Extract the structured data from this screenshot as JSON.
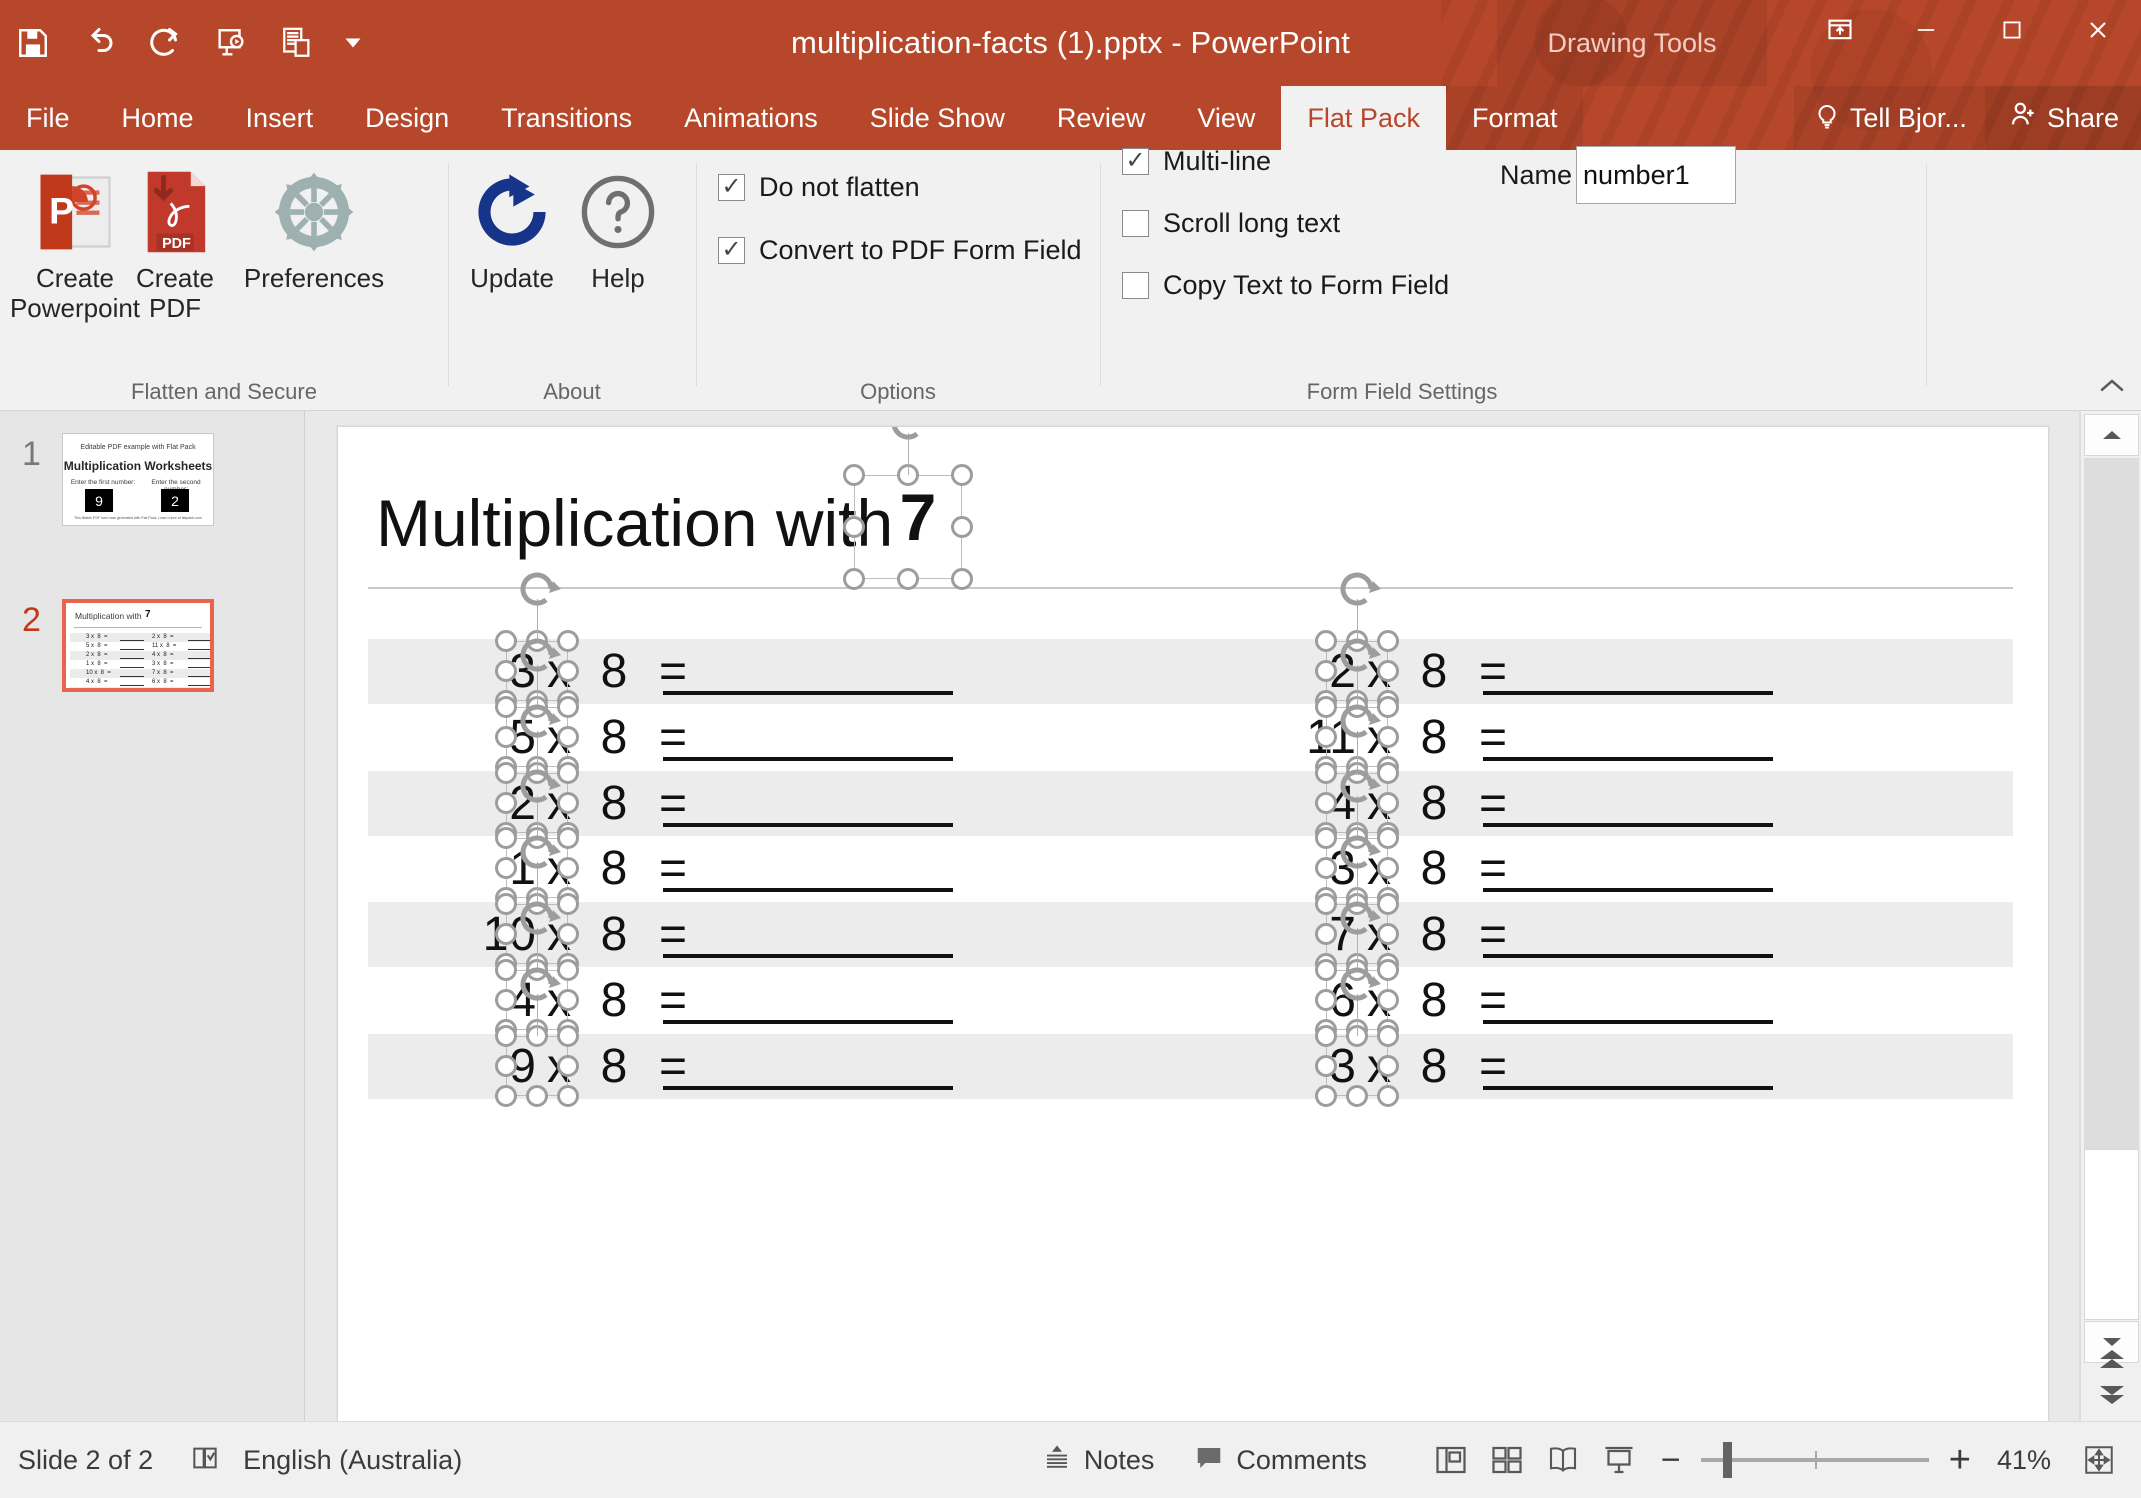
{
  "window": {
    "document_title": "multiplication-facts (1).pptx - PowerPoint",
    "contextual_tools_label": "Drawing Tools",
    "quick_access": [
      {
        "name": "save-icon",
        "label": "Save"
      },
      {
        "name": "undo-icon",
        "label": "Undo"
      },
      {
        "name": "redo-icon",
        "label": "Redo"
      },
      {
        "name": "start-from-beginning-icon",
        "label": "Start From Beginning"
      },
      {
        "name": "print-preview-icon",
        "label": "Print Preview and Print"
      },
      {
        "name": "customize-quick-access-toolbar-icon",
        "label": "Customize Quick Access Toolbar"
      }
    ],
    "controls": [
      {
        "name": "ribbon-display-options-icon",
        "label": "Ribbon Display Options"
      },
      {
        "name": "minimize-icon",
        "label": "Minimize"
      },
      {
        "name": "restore-icon",
        "label": "Restore Down"
      },
      {
        "name": "close-icon",
        "label": "Close"
      }
    ]
  },
  "ribbon": {
    "tabs": [
      {
        "label": "File",
        "active": false
      },
      {
        "label": "Home",
        "active": false
      },
      {
        "label": "Insert",
        "active": false
      },
      {
        "label": "Design",
        "active": false
      },
      {
        "label": "Transitions",
        "active": false
      },
      {
        "label": "Animations",
        "active": false
      },
      {
        "label": "Slide Show",
        "active": false
      },
      {
        "label": "Review",
        "active": false
      },
      {
        "label": "View",
        "active": false
      },
      {
        "label": "Flat Pack",
        "active": true
      },
      {
        "label": "Format",
        "active": false,
        "contextual": true
      }
    ],
    "tell_me": "Tell Bjor...",
    "share": "Share",
    "groups": [
      {
        "title": "Flatten and Secure",
        "buttons": [
          {
            "label_line1": "Create",
            "label_line2": "Powerpoint",
            "icon": "powerpoint-file-icon"
          },
          {
            "label_line1": "Create",
            "label_line2": "PDF",
            "icon": "pdf-file-icon"
          },
          {
            "label_line1": "Preferences",
            "label_line2": "",
            "icon": "gear-icon"
          }
        ]
      },
      {
        "title": "About",
        "buttons": [
          {
            "label_line1": "Update",
            "label_line2": "",
            "icon": "refresh-circle-icon"
          },
          {
            "label_line1": "Help",
            "label_line2": "",
            "icon": "question-mark-icon"
          }
        ]
      },
      {
        "title": "Options",
        "checkboxes": [
          {
            "label": "Do not flatten",
            "checked": true
          },
          {
            "label": "Convert to PDF Form Field",
            "checked": true
          }
        ]
      },
      {
        "title": "Form Field Settings",
        "checkboxes": [
          {
            "label": "Multi-line",
            "checked": true
          },
          {
            "label": "Scroll long text",
            "checked": false
          },
          {
            "label": "Copy Text to Form Field",
            "checked": false
          }
        ],
        "name_label": "Name",
        "name_value": "number1"
      }
    ],
    "collapse_label": "Collapse the Ribbon"
  },
  "thumbnails": [
    {
      "number": "1",
      "active": false,
      "subtitle": "Editable PDF example with Flat Pack",
      "title": "Multiplication Worksheets",
      "caption_left": "Enter the first number:",
      "caption_right": "Enter the second number:",
      "value_left": "9",
      "value_right": "2",
      "footer": "This fillable PDF form was generated with Flat Pack. Learn more at flatpack.com"
    },
    {
      "number": "2",
      "active": true,
      "title": "Multiplication with",
      "number_value": "7",
      "rows": [
        {
          "left_a": "3",
          "left_b": "8",
          "right_a": "2",
          "right_b": "8"
        },
        {
          "left_a": "5",
          "left_b": "8",
          "right_a": "11",
          "right_b": "8"
        },
        {
          "left_a": "2",
          "left_b": "8",
          "right_a": "4",
          "right_b": "8"
        },
        {
          "left_a": "1",
          "left_b": "8",
          "right_a": "3",
          "right_b": "8"
        },
        {
          "left_a": "10",
          "left_b": "8",
          "right_a": "7",
          "right_b": "8"
        },
        {
          "left_a": "4",
          "left_b": "8",
          "right_a": "6",
          "right_b": "8"
        },
        {
          "left_a": "9",
          "left_b": "8",
          "right_a": "3",
          "right_b": "8"
        }
      ]
    }
  ],
  "slide": {
    "title": "Multiplication with",
    "title_number": "7",
    "times_symbol": "x",
    "equals_symbol": "=",
    "rows": [
      {
        "left": {
          "a": "3",
          "b": "8"
        },
        "right": {
          "a": "2",
          "b": "8"
        }
      },
      {
        "left": {
          "a": "5",
          "b": "8"
        },
        "right": {
          "a": "11",
          "b": "8"
        }
      },
      {
        "left": {
          "a": "2",
          "b": "8"
        },
        "right": {
          "a": "4",
          "b": "8"
        }
      },
      {
        "left": {
          "a": "1",
          "b": "8"
        },
        "right": {
          "a": "3",
          "b": "8"
        }
      },
      {
        "left": {
          "a": "10",
          "b": "8"
        },
        "right": {
          "a": "7",
          "b": "8"
        }
      },
      {
        "left": {
          "a": "4",
          "b": "8"
        },
        "right": {
          "a": "6",
          "b": "8"
        }
      },
      {
        "left": {
          "a": "9",
          "b": "8"
        },
        "right": {
          "a": "3",
          "b": "8"
        }
      }
    ]
  },
  "statusbar": {
    "slide_counter": "Slide 2 of 2",
    "spellcheck_icon": "spellcheck-icon",
    "language": "English (Australia)",
    "notes_label": "Notes",
    "comments_label": "Comments",
    "view_buttons": [
      {
        "name": "normal-view-icon",
        "label": "Normal"
      },
      {
        "name": "slide-sorter-view-icon",
        "label": "Slide Sorter"
      },
      {
        "name": "reading-view-icon",
        "label": "Reading View"
      },
      {
        "name": "slide-show-view-icon",
        "label": "Slide Show"
      }
    ],
    "zoom_out_label": "−",
    "zoom_in_label": "+",
    "zoom_level": "41%",
    "fit_label": "Fit slide to current window"
  },
  "colors": {
    "brand_red": "#b7472a",
    "accent_orange": "#e8644a",
    "ribbon_bg": "#f1f1f1",
    "pane_bg": "#e6e6e6",
    "editor_bg": "#e9e9e9",
    "row_shade": "#ececec"
  }
}
